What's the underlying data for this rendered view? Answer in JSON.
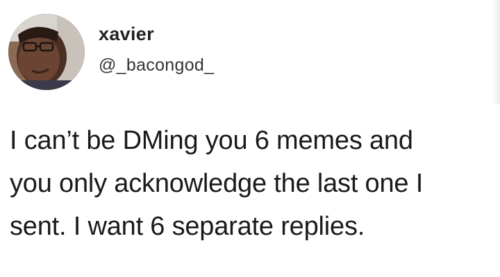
{
  "user": {
    "display_name": "xavier",
    "handle": "@_bacongod_",
    "avatar_icon": "profile-photo"
  },
  "tweet": {
    "lines": [
      "I can’t be DMing you 6 memes and",
      "you only acknowledge the last one I",
      "sent. I want 6 separate replies."
    ]
  },
  "colors": {
    "background": "#ffffff",
    "text": "#1a1a1a"
  }
}
